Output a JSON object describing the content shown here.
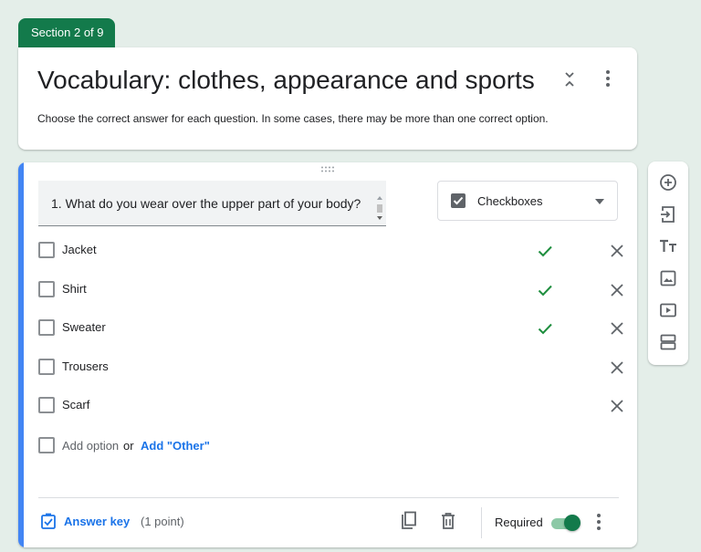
{
  "section": {
    "label": "Section 2 of 9"
  },
  "header": {
    "title": "Vocabulary: clothes, appearance and sports",
    "description": "Choose the correct answer for each question. In some cases, there may be more than one correct option."
  },
  "question": {
    "text": "1. What do you wear over the upper part of your body?",
    "type": "Checkboxes",
    "options": [
      {
        "label": "Jacket",
        "correct": true
      },
      {
        "label": "Shirt",
        "correct": true
      },
      {
        "label": "Sweater",
        "correct": true
      },
      {
        "label": "Trousers",
        "correct": false
      },
      {
        "label": "Scarf",
        "correct": false
      }
    ],
    "add_option": {
      "label": "Add option",
      "or": "or",
      "other": "Add \"Other\""
    },
    "footer": {
      "answer_key": "Answer key",
      "points": "(1 point)",
      "required_label": "Required",
      "required": true
    }
  },
  "colors": {
    "brand": "#137a4b",
    "accent": "#4285f4",
    "link": "#1a73e8",
    "correct": "#1e8e3e",
    "background": "#e4eee9"
  },
  "toolbar": {
    "tools": [
      "add-question-icon",
      "import-questions-icon",
      "add-title-icon",
      "add-image-icon",
      "add-video-icon",
      "add-section-icon"
    ]
  }
}
